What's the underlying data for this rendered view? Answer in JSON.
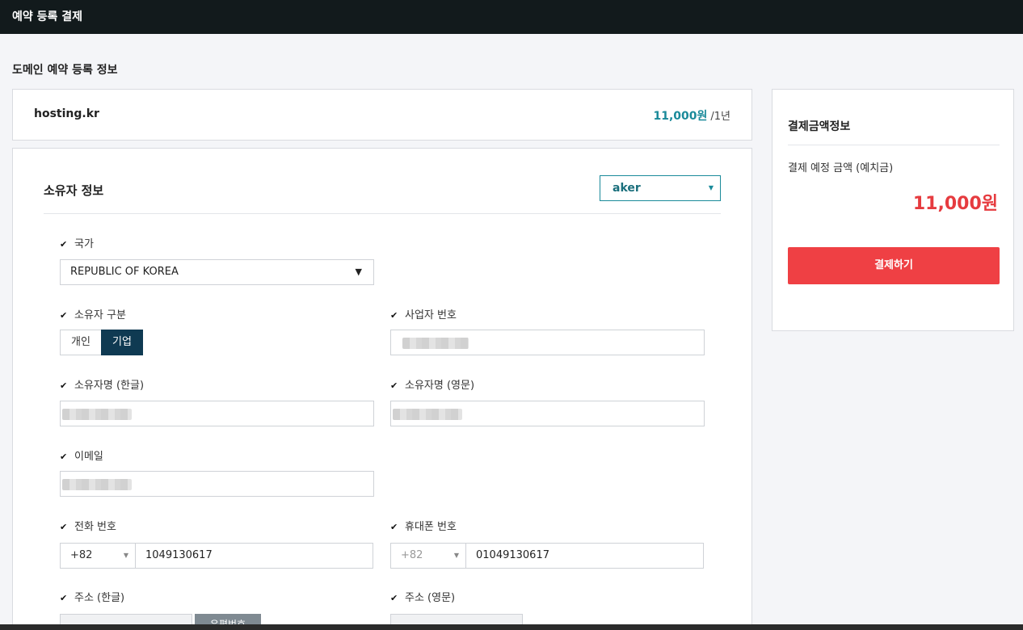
{
  "header": {
    "title": "예약 등록 결제"
  },
  "section": {
    "title": "도메인 예약 등록 정보"
  },
  "domain": {
    "name": "hosting.kr",
    "price": "11,000원",
    "period": "/1년"
  },
  "owner": {
    "title": "소유자 정보",
    "selected_owner": "aker",
    "fields": {
      "country": {
        "label": "국가",
        "value": "REPUBLIC OF KOREA"
      },
      "owner_type": {
        "label": "소유자 구분",
        "options": [
          "개인",
          "기업"
        ],
        "selected": "기업"
      },
      "business_number": {
        "label": "사업자 번호"
      },
      "owner_name_kr": {
        "label": "소유자명 (한글)"
      },
      "owner_name_en": {
        "label": "소유자명 (영문)"
      },
      "email": {
        "label": "이메일"
      },
      "phone": {
        "label": "전화 번호",
        "code": "+82",
        "value": "1049130617"
      },
      "mobile": {
        "label": "휴대폰 번호",
        "code": "+82",
        "value": "01049130617"
      },
      "address_kr": {
        "label": "주소 (한글)",
        "postal_button": "우편번호"
      },
      "address_en": {
        "label": "주소 (영문)"
      }
    }
  },
  "payment": {
    "title": "결제금액정보",
    "label": "결제 예정 금액 (예치금)",
    "amount": "11,000원",
    "button": "결제하기"
  },
  "icons": {
    "check": "checkmark-icon",
    "dropdown": "caret-down-icon"
  },
  "colors": {
    "header_bg": "#121a1c",
    "accent_teal": "#1a8a9a",
    "selected_segment": "#0f3a52",
    "pay_red": "#ef4044",
    "amount_red": "#e63b3f"
  }
}
